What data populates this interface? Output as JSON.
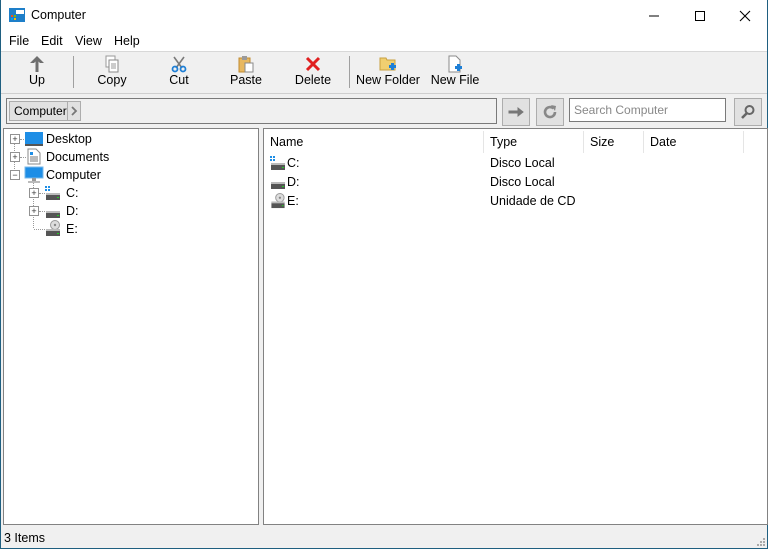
{
  "window": {
    "title": "Computer",
    "icon": "computer-folder-icon",
    "controls": {
      "minimize": "minimize-icon",
      "maximize": "maximize-icon",
      "close": "close-icon"
    }
  },
  "menu": [
    "File",
    "Edit",
    "View",
    "Help"
  ],
  "toolbar": {
    "up": {
      "label": "Up",
      "icon": "arrow-up-icon"
    },
    "copy": {
      "label": "Copy",
      "icon": "copy-icon"
    },
    "cut": {
      "label": "Cut",
      "icon": "scissors-icon"
    },
    "paste": {
      "label": "Paste",
      "icon": "clipboard-icon"
    },
    "delete": {
      "label": "Delete",
      "icon": "red-x-icon"
    },
    "new_folder": {
      "label": "New Folder",
      "icon": "new-folder-icon"
    },
    "new_file": {
      "label": "New File",
      "icon": "new-file-icon"
    }
  },
  "address": {
    "breadcrumb": [
      "Computer"
    ],
    "go_icon": "arrow-right-icon",
    "refresh_icon": "refresh-icon",
    "search_placeholder": "Search Computer",
    "search_value": "",
    "search_icon": "magnifier-icon"
  },
  "tree": [
    {
      "label": "Desktop",
      "icon": "desktop-icon",
      "expander": "+"
    },
    {
      "label": "Documents",
      "icon": "documents-icon",
      "expander": "+"
    },
    {
      "label": "Computer",
      "icon": "computer-icon",
      "expander": "-",
      "children": [
        {
          "label": "C:",
          "icon": "system-drive-icon",
          "expander": "+"
        },
        {
          "label": "D:",
          "icon": "drive-icon",
          "expander": "+"
        },
        {
          "label": "E:",
          "icon": "cd-drive-icon"
        }
      ]
    }
  ],
  "list": {
    "columns": [
      "Name",
      "Type",
      "Size",
      "Date"
    ],
    "rows": [
      {
        "name": "C:",
        "type": "Disco Local",
        "size": "",
        "date": "",
        "icon": "system-drive-icon"
      },
      {
        "name": "D:",
        "type": "Disco Local",
        "size": "",
        "date": "",
        "icon": "drive-icon"
      },
      {
        "name": "E:",
        "type": "Unidade de CD",
        "size": "",
        "date": "",
        "icon": "cd-drive-icon"
      }
    ]
  },
  "status": {
    "text": "3 Items"
  },
  "colors": {
    "accent": "#1e90d6",
    "delete": "#e02020",
    "folder": "#e8c45a"
  }
}
